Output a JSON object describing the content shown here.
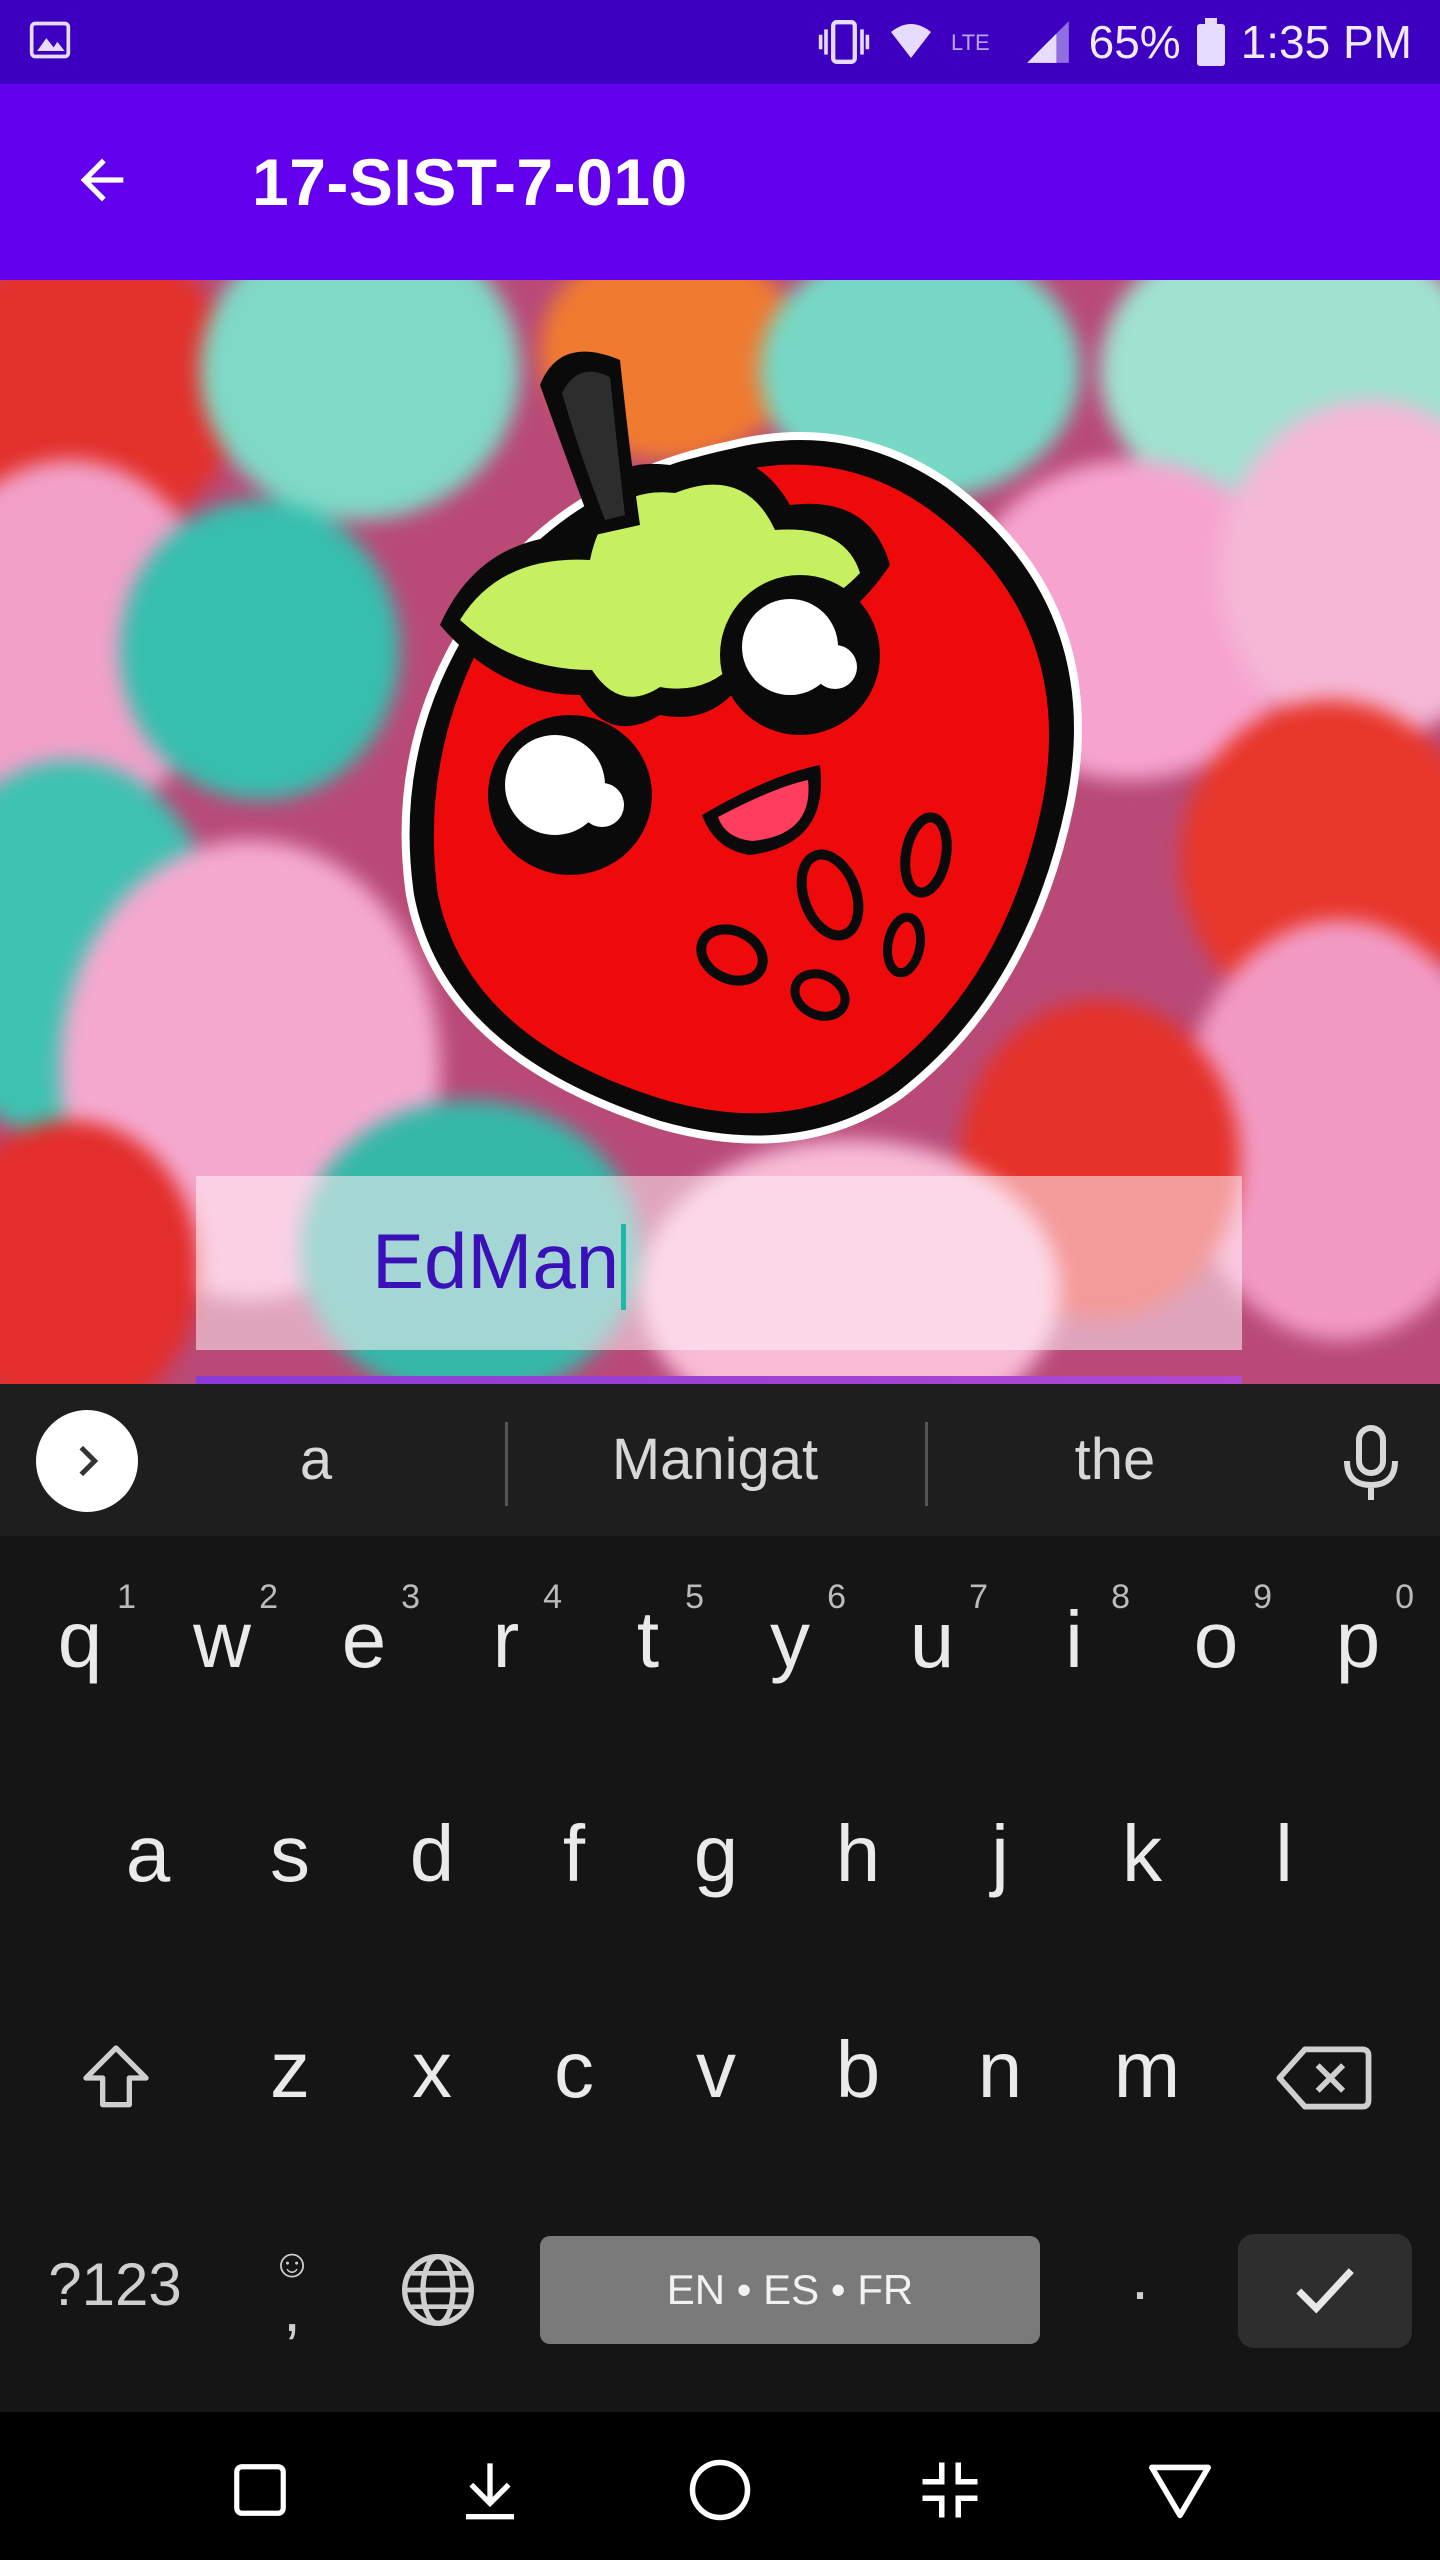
{
  "status_bar": {
    "battery_percent": "65%",
    "time": "1:35 PM",
    "icons": [
      "gallery-icon",
      "vibrate-icon",
      "wifi-icon",
      "lte-icon",
      "signal-icon",
      "battery-icon"
    ]
  },
  "app_bar": {
    "title": "17-SIST-7-010",
    "back_icon": "arrow-back-icon"
  },
  "colors": {
    "status_bar": "#3d00c0",
    "app_bar": "#6200ee",
    "input_text": "#3a10b8",
    "caret": "#1fb8a8",
    "keyboard_bg": "#151515"
  },
  "name_input": {
    "value": "EdMan"
  },
  "keyboard": {
    "suggestions": [
      "a",
      "Manigat",
      "the"
    ],
    "row1": [
      {
        "key": "q",
        "hint": "1"
      },
      {
        "key": "w",
        "hint": "2"
      },
      {
        "key": "e",
        "hint": "3"
      },
      {
        "key": "r",
        "hint": "4"
      },
      {
        "key": "t",
        "hint": "5"
      },
      {
        "key": "y",
        "hint": "6"
      },
      {
        "key": "u",
        "hint": "7"
      },
      {
        "key": "i",
        "hint": "8"
      },
      {
        "key": "o",
        "hint": "9"
      },
      {
        "key": "p",
        "hint": "0"
      }
    ],
    "row2": [
      "a",
      "s",
      "d",
      "f",
      "g",
      "h",
      "j",
      "k",
      "l"
    ],
    "row3": [
      "z",
      "x",
      "c",
      "v",
      "b",
      "n",
      "m"
    ],
    "symbols_label": "?123",
    "comma_label": ",",
    "space_label": "EN • ES • FR",
    "period_label": "."
  },
  "nav_bar": {
    "icons": [
      "recents-icon",
      "notification-pull-icon",
      "home-icon",
      "minimize-icon",
      "back-triangle-icon"
    ]
  }
}
